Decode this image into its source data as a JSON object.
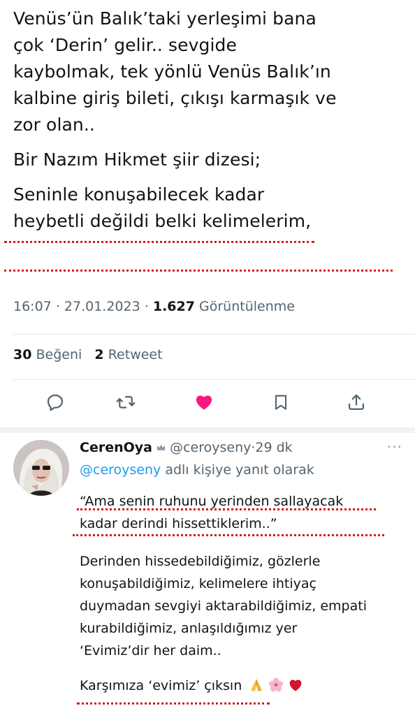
{
  "tweet": {
    "paragraph1": [
      "Venüs’ün Balık’taki yerleşimi bana",
      "çok ‘Derin’ gelir.. sevgide",
      "kaybolmak, tek yönlü Venüs Balık’ın",
      "kalbine giriş bileti, çıkışı karmaşık ve",
      "zor olan.."
    ],
    "paragraph2": "Bir Nazım Hikmet şiir dizesi;",
    "paragraph3": [
      "Seninle konuşabilecek kadar",
      "heybetli değildi belki kelimelerim,"
    ],
    "time": "16:07",
    "date": "27.01.2023",
    "views_count": "1.627",
    "views_label": "Görüntülenme",
    "likes_count": "30",
    "likes_label": "Beğeni",
    "retweets_count": "2",
    "retweets_label": "Retweet",
    "separator": "·"
  },
  "actions": {
    "reply_icon": "comment-icon",
    "retweet_icon": "retweet-icon",
    "like_icon": "heart-filled-icon",
    "bookmark_icon": "bookmark-icon",
    "share_icon": "share-icon",
    "like_color": "#f91880",
    "icon_color": "#536471"
  },
  "reply": {
    "name": "CerenOya",
    "handle": "@ceroyseny",
    "time_ago": "29 dk",
    "more": "···",
    "in_reply_handle": "@ceroyseny",
    "in_reply_text": "adlı kişiye yanıt olarak",
    "quote": [
      "“Ama senin ruhunu yerinden sallayacak",
      "kadar derindi hissettiklerim..”"
    ],
    "body": [
      "Derinden hissedebildiğimiz, gözlerle",
      "konuşabildiğimiz, kelimelere ihtiyaç",
      "duymadan sevgiyi aktarabildiğimiz, empati",
      "kurabildiğimiz, anlaşıldığımız yer",
      "‘Evimiz’dir her daim.."
    ],
    "closing": "Karşımıza ‘evimiz’ çıksın",
    "emojis": [
      "folded-hands",
      "cherry-blossom",
      "red-heart"
    ]
  },
  "colors": {
    "text": "#0f1419",
    "secondary": "#536471",
    "link": "#1d9bf0",
    "annotation_dots": "#d11c1c"
  }
}
